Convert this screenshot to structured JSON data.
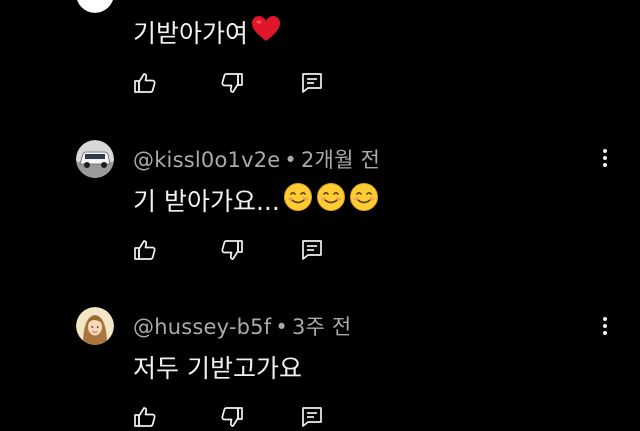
{
  "comments": [
    {
      "author": "",
      "age": "",
      "text": "기받아가여",
      "emojis": [
        "red-heart"
      ],
      "avatar": "car",
      "actions": [
        "like",
        "dislike",
        "reply"
      ]
    },
    {
      "author": "@kissl0o1v2e",
      "separator": "•",
      "age": "2개월 전",
      "text": "기 받아가요...",
      "emojis": [
        "smiling-face",
        "smiling-face",
        "smiling-face"
      ],
      "avatar": "car",
      "actions": [
        "like",
        "dislike",
        "reply"
      ]
    },
    {
      "author": "@hussey-b5f",
      "separator": "•",
      "age": "3주 전",
      "text": "저두 기받고가요",
      "emojis": [],
      "avatar": "portrait",
      "actions": [
        "like",
        "dislike",
        "reply"
      ]
    }
  ],
  "colors": {
    "background": "#000000",
    "text": "#f1f1f1",
    "meta": "#aaaaaa",
    "heart": "#e0162b",
    "emoji_face": "#ffcc33"
  }
}
